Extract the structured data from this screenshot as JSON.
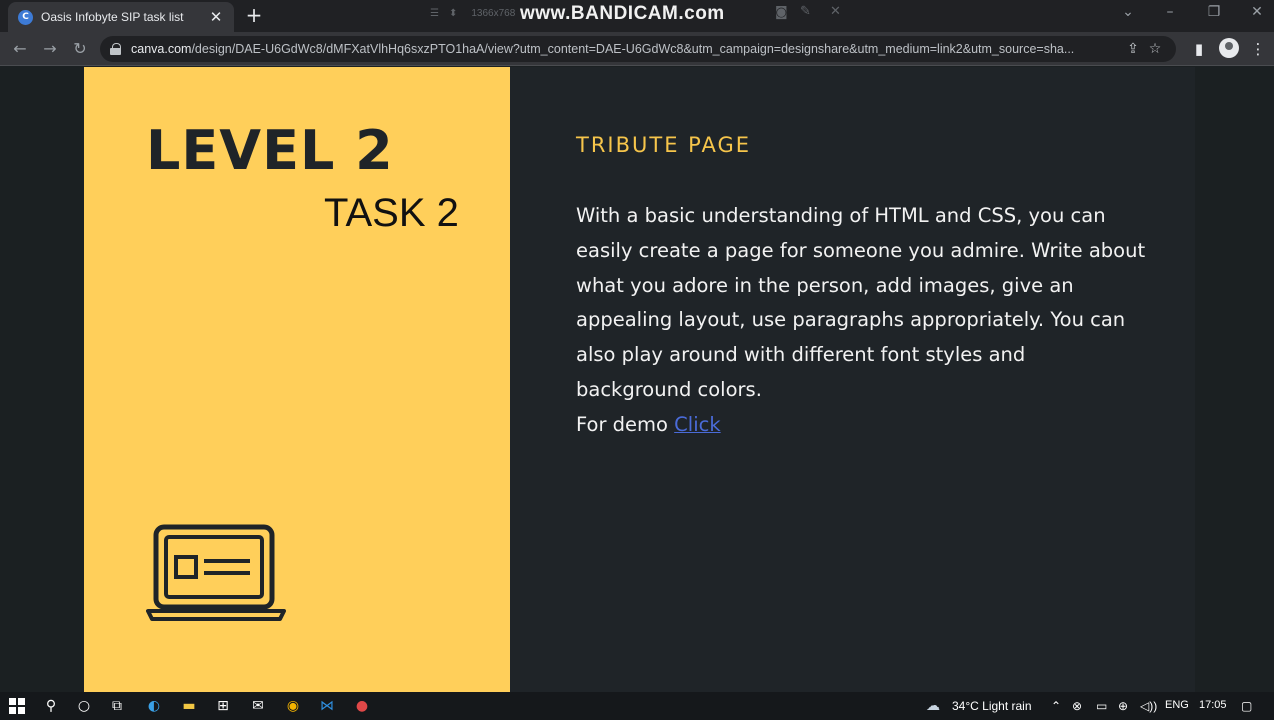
{
  "browser": {
    "tab_title": "Oasis Infobyte SIP task list",
    "tab_favicon_letter": "C",
    "new_tab_label": "+",
    "close_tab_label": "✕",
    "url_host": "canva.com",
    "url_path": "/design/DAE-U6GdWc8/dMFXatVlhHq6sxzPTO1haA/view?utm_content=DAE-U6GdWc8&utm_campaign=designshare&utm_medium=link2&utm_source=sha...",
    "icons": [
      "back-icon",
      "forward-icon",
      "reload-icon",
      "lock-icon",
      "share-icon",
      "star-icon",
      "sidebar-icon",
      "profile-icon",
      "menu-icon"
    ]
  },
  "recorder": {
    "resolution": "1366x768",
    "watermark": "www.BANDICAM.com"
  },
  "slide": {
    "level_title": "LEVEL 2",
    "task_title": "TASK 2",
    "heading": "TRIBUTE PAGE",
    "body": "With a basic understanding of HTML and CSS, you can easily create a page for someone you admire. Write about what you adore in the person, add images, give an appealing layout, use paragraphs appropriately. You can also play around with different font styles and background colors.",
    "demo_prefix": "For demo ",
    "demo_link": "Click",
    "colors": {
      "panel": "#ffcf5a",
      "heading": "#f6c54b",
      "background": "#1f2428",
      "link": "#4a6bd8"
    }
  },
  "taskbar": {
    "weather": "34°C  Light rain",
    "language": "ENG",
    "time": "17:05"
  }
}
